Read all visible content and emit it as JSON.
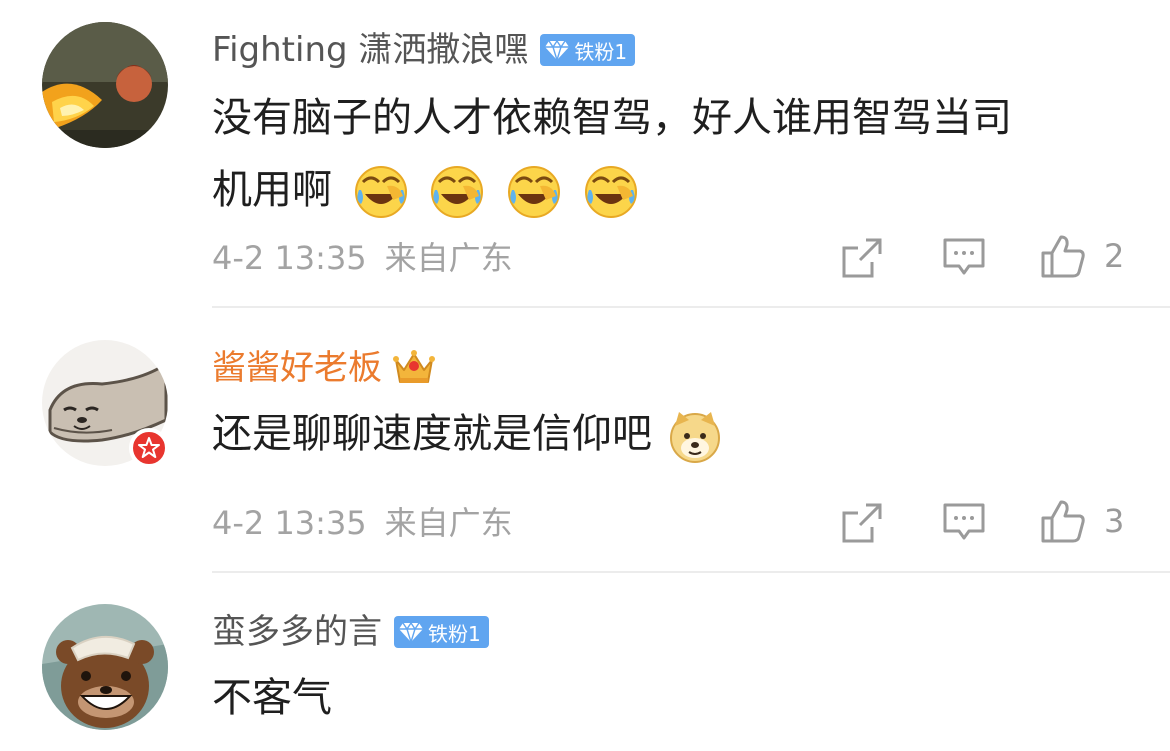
{
  "comments": [
    {
      "username": "Fighting 潇洒撒浪嘿",
      "badge": "铁粉1",
      "text_line1": "没有脑子的人才依赖智驾，好人谁用智驾当司",
      "text_line2": "机用啊",
      "emojis": [
        "laugh-cry-emoji",
        "laugh-cry-emoji",
        "laugh-cry-emoji",
        "laugh-cry-emoji"
      ],
      "time": "4-2 13:35",
      "location": "来自广东",
      "likes": "2"
    },
    {
      "username": "酱酱好老板",
      "text_line1": "还是聊聊速度就是信仰吧",
      "emojis": [
        "doge-emoji"
      ],
      "time": "4-2 13:35",
      "location": "来自广东",
      "likes": "3"
    },
    {
      "username": "蛮多多的言",
      "badge": "铁粉1",
      "text_line1": "不客气"
    }
  ],
  "colors": {
    "vip_name": "#eb7b2e",
    "name": "#555555",
    "meta": "#a3a3a3",
    "badge": "#60a5f0",
    "verified": "#e8352f"
  }
}
